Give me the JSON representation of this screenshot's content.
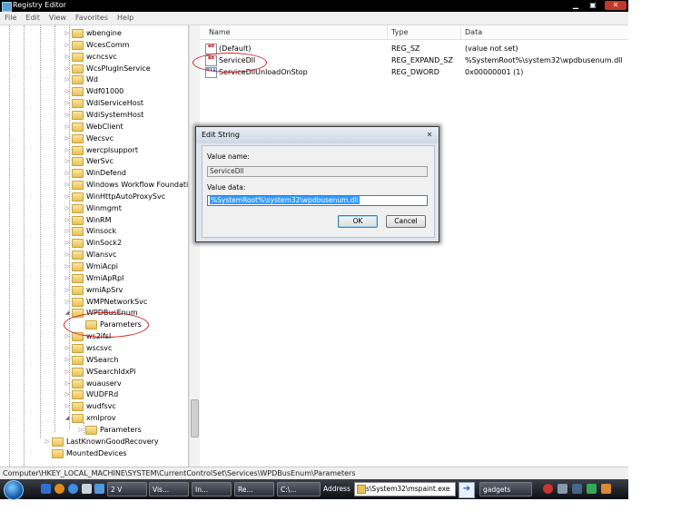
{
  "window": {
    "title": "Registry Editor",
    "min": "▁",
    "max": "▣",
    "close": "✕"
  },
  "menu": [
    "File",
    "Edit",
    "View",
    "Favorites",
    "Help"
  ],
  "tree": {
    "items": [
      {
        "label": "wbengine",
        "exp": "▷",
        "indent": 2
      },
      {
        "label": "WcesComm",
        "exp": "▷",
        "indent": 2
      },
      {
        "label": "wcncsvc",
        "exp": "▷",
        "indent": 2
      },
      {
        "label": "WcsPlugInService",
        "exp": "▷",
        "indent": 2
      },
      {
        "label": "Wd",
        "exp": "▷",
        "indent": 2
      },
      {
        "label": "Wdf01000",
        "exp": "▷",
        "indent": 2
      },
      {
        "label": "WdiServiceHost",
        "exp": "▷",
        "indent": 2
      },
      {
        "label": "WdiSystemHost",
        "exp": "▷",
        "indent": 2
      },
      {
        "label": "WebClient",
        "exp": "▷",
        "indent": 2
      },
      {
        "label": "Wecsvc",
        "exp": "▷",
        "indent": 2
      },
      {
        "label": "wercplsupport",
        "exp": "▷",
        "indent": 2
      },
      {
        "label": "WerSvc",
        "exp": "▷",
        "indent": 2
      },
      {
        "label": "WinDefend",
        "exp": "▷",
        "indent": 2
      },
      {
        "label": "Windows Workflow Foundation",
        "exp": "▷",
        "indent": 2
      },
      {
        "label": "WinHttpAutoProxySvc",
        "exp": "▷",
        "indent": 2
      },
      {
        "label": "Winmgmt",
        "exp": "▷",
        "indent": 2
      },
      {
        "label": "WinRM",
        "exp": "▷",
        "indent": 2
      },
      {
        "label": "Winsock",
        "exp": "▷",
        "indent": 2
      },
      {
        "label": "WinSock2",
        "exp": "▷",
        "indent": 2
      },
      {
        "label": "Wlansvc",
        "exp": "▷",
        "indent": 2
      },
      {
        "label": "WmiAcpi",
        "exp": "▷",
        "indent": 2
      },
      {
        "label": "WmiApRpl",
        "exp": "▷",
        "indent": 2
      },
      {
        "label": "wmiApSrv",
        "exp": "▷",
        "indent": 2
      },
      {
        "label": "WMPNetworkSvc",
        "exp": "▷",
        "indent": 2
      },
      {
        "label": "WPDBusEnum",
        "exp": "◢",
        "indent": 2
      },
      {
        "label": "Parameters",
        "exp": "",
        "indent": 3
      },
      {
        "label": "ws2ifsl",
        "exp": "▷",
        "indent": 2
      },
      {
        "label": "wscsvc",
        "exp": "▷",
        "indent": 2
      },
      {
        "label": "WSearch",
        "exp": "▷",
        "indent": 2
      },
      {
        "label": "WSearchIdxPi",
        "exp": "▷",
        "indent": 2
      },
      {
        "label": "wuauserv",
        "exp": "▷",
        "indent": 2
      },
      {
        "label": "WUDFRd",
        "exp": "▷",
        "indent": 2
      },
      {
        "label": "wudfsvc",
        "exp": "▷",
        "indent": 2
      },
      {
        "label": "xmlprov",
        "exp": "◢",
        "indent": 2
      },
      {
        "label": "Parameters",
        "exp": "▷",
        "indent": 3
      },
      {
        "label": "LastKnownGoodRecovery",
        "exp": "▷",
        "indent": 1
      },
      {
        "label": "MountedDevices",
        "exp": "",
        "indent": 1
      }
    ]
  },
  "list": {
    "columns": [
      "Name",
      "Type",
      "Data"
    ],
    "rows": [
      {
        "name": "(Default)",
        "type": "REG_SZ",
        "data": "(value not set)",
        "icon": "ab"
      },
      {
        "name": "ServiceDll",
        "type": "REG_EXPAND_SZ",
        "data": "%SystemRoot%\\system32\\wpdbusenum.dll",
        "icon": "ab"
      },
      {
        "name": "ServiceDllUnloadOnStop",
        "type": "REG_DWORD",
        "data": "0x00000001 (1)",
        "icon": "011"
      }
    ]
  },
  "status": "Computer\\HKEY_LOCAL_MACHINE\\SYSTEM\\CurrentControlSet\\Services\\WPDBusEnum\\Parameters",
  "dialog": {
    "title": "Edit String",
    "close": "✕",
    "value_name_label": "Value name:",
    "value_name": "ServiceDll",
    "value_data_label": "Value data:",
    "value_data": "%SystemRoot%\\system32\\wpdbusenum.dll",
    "ok": "OK",
    "cancel": "Cancel"
  },
  "taskbar": {
    "buttons": [
      "2 V",
      "Vis...",
      "In...",
      "Re...",
      "C:\\...",
      "gadgets"
    ],
    "address_label": "Address",
    "address_value": "s\\System32\\mspaint.exe",
    "go": "➜"
  },
  "colors": {
    "annotation": "#d02020",
    "selection": "#3399ff"
  }
}
